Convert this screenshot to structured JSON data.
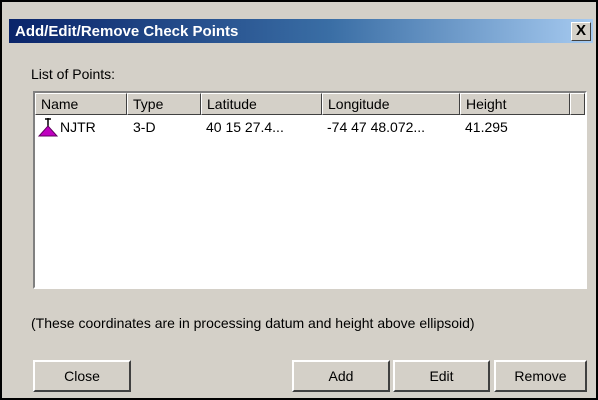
{
  "window": {
    "title": "Add/Edit/Remove Check Points",
    "close_glyph": "X"
  },
  "list": {
    "caption": "List of Points:",
    "columns": [
      "Name",
      "Type",
      "Latitude",
      "Longitude",
      "Height"
    ],
    "rows": [
      {
        "icon": "triangle-point-icon",
        "name": "NJTR",
        "type": "3-D",
        "latitude": "40 15 27.4...",
        "longitude": "-74 47 48.072...",
        "height": "41.295"
      }
    ]
  },
  "note": "(These coordinates are in processing datum and height above ellipsoid)",
  "buttons": {
    "close": "Close",
    "add": "Add",
    "edit": "Edit",
    "remove": "Remove"
  },
  "colors": {
    "titlebar_start": "#0a246a",
    "titlebar_end": "#a6caf0",
    "icon_fill": "#c000c0",
    "face": "#d4d0c8"
  }
}
